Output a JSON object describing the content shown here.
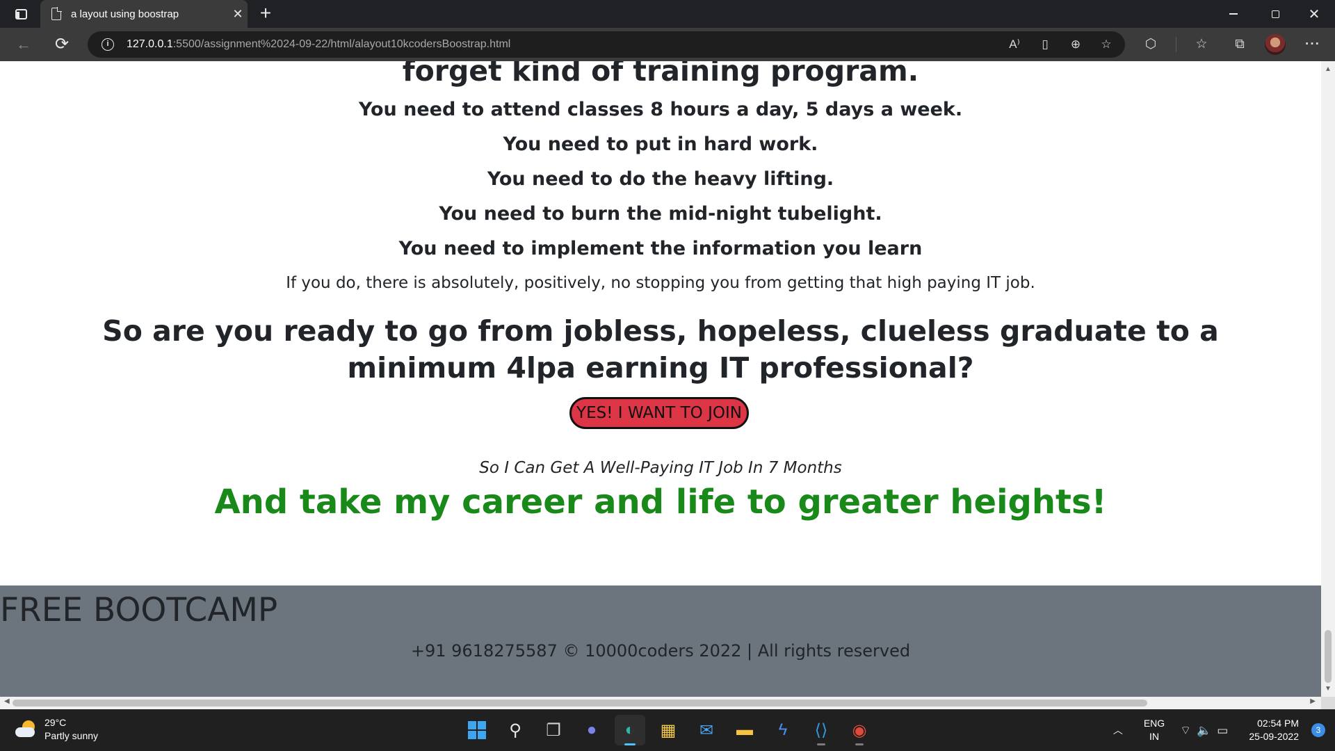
{
  "browser": {
    "tab_title": "a layout using boostrap",
    "tab_close": "✕",
    "new_tab": "+",
    "url_host": "127.0.0.1",
    "url_path": ":5500/assignment%2024-09-22/html/alayout10kcodersBoostrap.html",
    "window_controls": {
      "close": "✕"
    }
  },
  "page": {
    "lead_heading": "forget kind of training program.",
    "need_lines": [
      "You need to attend classes 8 hours a day, 5 days a week.",
      "You need to put in hard work.",
      "You need to do the heavy lifting.",
      "You need to burn the mid-night tubelight.",
      "You need to implement the information you learn"
    ],
    "note": "If you do, there is absolutely, positively, no stopping you from getting that high paying IT job.",
    "big_question": "So are you ready to go from jobless, hopeless, clueless graduate to a minimum 4lpa earning IT professional?",
    "join_button": "YES! I WANT TO JOIN",
    "subline": "So I Can Get A Well-Paying IT Job In 7 Months",
    "green_heading": "And take my career and life to greater heights!",
    "footer": {
      "title": "FREE BOOTCAMP",
      "copyright": "+91 9618275587 © 10000coders 2022 | All rights reserved"
    }
  },
  "colors": {
    "join_button_bg": "#dc3545",
    "green_heading": "#198a1a",
    "footer_bg": "#6c757d"
  },
  "taskbar": {
    "weather_temp": "29°C",
    "weather_desc": "Partly sunny",
    "lang_primary": "ENG",
    "lang_secondary": "IN",
    "time": "02:54 PM",
    "date": "25-09-2022",
    "notification_count": "3",
    "icons": [
      "windows-start-icon",
      "search-icon",
      "task-view-icon",
      "chat-icon",
      "edge-icon",
      "store-icon",
      "mail-icon",
      "file-explorer-icon",
      "power-automate-icon",
      "vscode-icon",
      "chrome-icon"
    ]
  }
}
